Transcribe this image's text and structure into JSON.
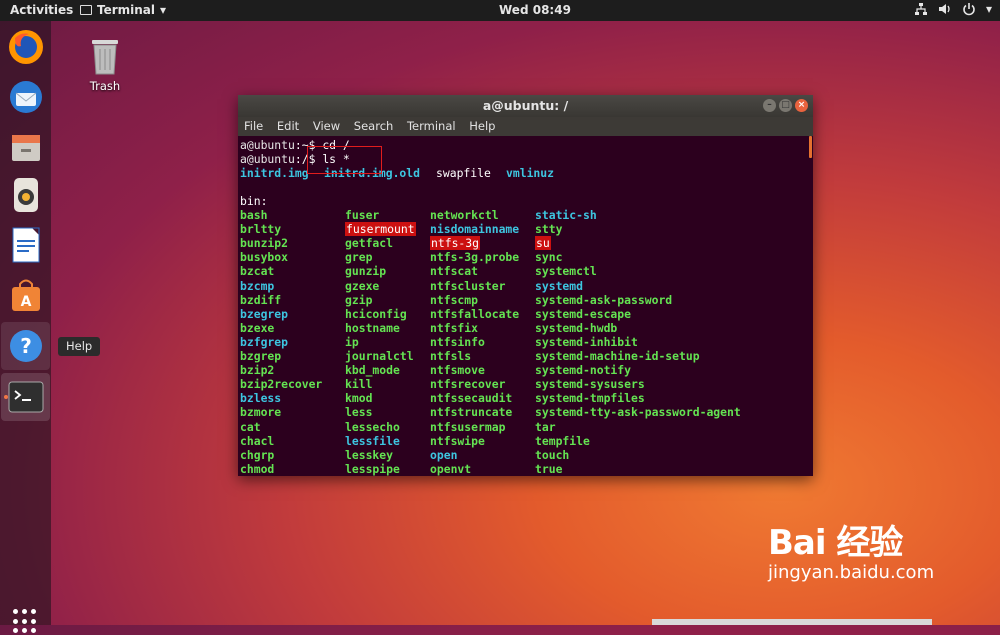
{
  "topbar": {
    "activities": "Activities",
    "app_name": "Terminal",
    "clock": "Wed 08:49",
    "status_icons": [
      "network-icon",
      "volume-icon",
      "power-icon"
    ]
  },
  "dock": {
    "apps": [
      "Firefox",
      "Thunderbird",
      "Files",
      "Rhythmbox",
      "LibreOffice Writer",
      "Ubuntu Software",
      "Help",
      "Terminal"
    ],
    "tooltip": "Help"
  },
  "desktop": {
    "trash_label": "Trash"
  },
  "terminal": {
    "title": "a@ubuntu: /",
    "menu": [
      "File",
      "Edit",
      "View",
      "Search",
      "Terminal",
      "Help"
    ],
    "prompt1": {
      "user": "a@ubuntu",
      "sep": ":",
      "path": "~",
      "dollar": "$ ",
      "command": "cd /"
    },
    "prompt2": {
      "user": "a@ubuntu",
      "sep": ":",
      "path": "/",
      "dollar": "$ ",
      "command": "ls *"
    },
    "root_files": [
      {
        "name": "initrd.img",
        "type": "link"
      },
      {
        "name": "initrd.img.old",
        "type": "link"
      },
      {
        "name": "swapfile",
        "type": "plain"
      },
      {
        "name": "vmlinuz",
        "type": "link"
      }
    ],
    "bin_header": "bin:",
    "bin_columns": [
      [
        {
          "n": "bash",
          "t": "exec"
        },
        {
          "n": "brltty",
          "t": "exec"
        },
        {
          "n": "bunzip2",
          "t": "exec"
        },
        {
          "n": "busybox",
          "t": "exec"
        },
        {
          "n": "bzcat",
          "t": "exec"
        },
        {
          "n": "bzcmp",
          "t": "link"
        },
        {
          "n": "bzdiff",
          "t": "exec"
        },
        {
          "n": "bzegrep",
          "t": "link"
        },
        {
          "n": "bzexe",
          "t": "exec"
        },
        {
          "n": "bzfgrep",
          "t": "link"
        },
        {
          "n": "bzgrep",
          "t": "exec"
        },
        {
          "n": "bzip2",
          "t": "exec"
        },
        {
          "n": "bzip2recover",
          "t": "exec"
        },
        {
          "n": "bzless",
          "t": "link"
        },
        {
          "n": "bzmore",
          "t": "exec"
        },
        {
          "n": "cat",
          "t": "exec"
        },
        {
          "n": "chacl",
          "t": "exec"
        },
        {
          "n": "chgrp",
          "t": "exec"
        },
        {
          "n": "chmod",
          "t": "exec"
        }
      ],
      [
        {
          "n": "fuser",
          "t": "exec"
        },
        {
          "n": "fusermount",
          "t": "suid"
        },
        {
          "n": "getfacl",
          "t": "exec"
        },
        {
          "n": "grep",
          "t": "exec"
        },
        {
          "n": "gunzip",
          "t": "exec"
        },
        {
          "n": "gzexe",
          "t": "exec"
        },
        {
          "n": "gzip",
          "t": "exec"
        },
        {
          "n": "hciconfig",
          "t": "exec"
        },
        {
          "n": "hostname",
          "t": "exec"
        },
        {
          "n": "ip",
          "t": "exec"
        },
        {
          "n": "journalctl",
          "t": "exec"
        },
        {
          "n": "kbd_mode",
          "t": "exec"
        },
        {
          "n": "kill",
          "t": "exec"
        },
        {
          "n": "kmod",
          "t": "exec"
        },
        {
          "n": "less",
          "t": "exec"
        },
        {
          "n": "lessecho",
          "t": "exec"
        },
        {
          "n": "lessfile",
          "t": "link"
        },
        {
          "n": "lesskey",
          "t": "exec"
        },
        {
          "n": "lesspipe",
          "t": "exec"
        }
      ],
      [
        {
          "n": "networkctl",
          "t": "exec"
        },
        {
          "n": "nisdomainname",
          "t": "link"
        },
        {
          "n": "ntfs-3g",
          "t": "suid"
        },
        {
          "n": "ntfs-3g.probe",
          "t": "exec"
        },
        {
          "n": "ntfscat",
          "t": "exec"
        },
        {
          "n": "ntfscluster",
          "t": "exec"
        },
        {
          "n": "ntfscmp",
          "t": "exec"
        },
        {
          "n": "ntfsfallocate",
          "t": "exec"
        },
        {
          "n": "ntfsfix",
          "t": "exec"
        },
        {
          "n": "ntfsinfo",
          "t": "exec"
        },
        {
          "n": "ntfsls",
          "t": "exec"
        },
        {
          "n": "ntfsmove",
          "t": "exec"
        },
        {
          "n": "ntfsrecover",
          "t": "exec"
        },
        {
          "n": "ntfssecaudit",
          "t": "exec"
        },
        {
          "n": "ntfstruncate",
          "t": "exec"
        },
        {
          "n": "ntfsusermap",
          "t": "exec"
        },
        {
          "n": "ntfswipe",
          "t": "exec"
        },
        {
          "n": "open",
          "t": "link"
        },
        {
          "n": "openvt",
          "t": "exec"
        }
      ],
      [
        {
          "n": "static-sh",
          "t": "link"
        },
        {
          "n": "stty",
          "t": "exec"
        },
        {
          "n": "su",
          "t": "suid"
        },
        {
          "n": "sync",
          "t": "exec"
        },
        {
          "n": "systemctl",
          "t": "exec"
        },
        {
          "n": "systemd",
          "t": "link"
        },
        {
          "n": "systemd-ask-password",
          "t": "exec"
        },
        {
          "n": "systemd-escape",
          "t": "exec"
        },
        {
          "n": "systemd-hwdb",
          "t": "exec"
        },
        {
          "n": "systemd-inhibit",
          "t": "exec"
        },
        {
          "n": "systemd-machine-id-setup",
          "t": "exec"
        },
        {
          "n": "systemd-notify",
          "t": "exec"
        },
        {
          "n": "systemd-sysusers",
          "t": "exec"
        },
        {
          "n": "systemd-tmpfiles",
          "t": "exec"
        },
        {
          "n": "systemd-tty-ask-password-agent",
          "t": "exec"
        },
        {
          "n": "tar",
          "t": "exec"
        },
        {
          "n": "tempfile",
          "t": "exec"
        },
        {
          "n": "touch",
          "t": "exec"
        },
        {
          "n": "true",
          "t": "exec"
        }
      ]
    ]
  },
  "watermark": {
    "logo": "Bai 经验",
    "url": "jingyan.baidu.com"
  },
  "colors": {
    "exec": "#64e352",
    "link": "#3dc5e0",
    "suid_bg": "#cc1010",
    "terminal_bg": "#2c001e",
    "accent": "#e5712f"
  }
}
